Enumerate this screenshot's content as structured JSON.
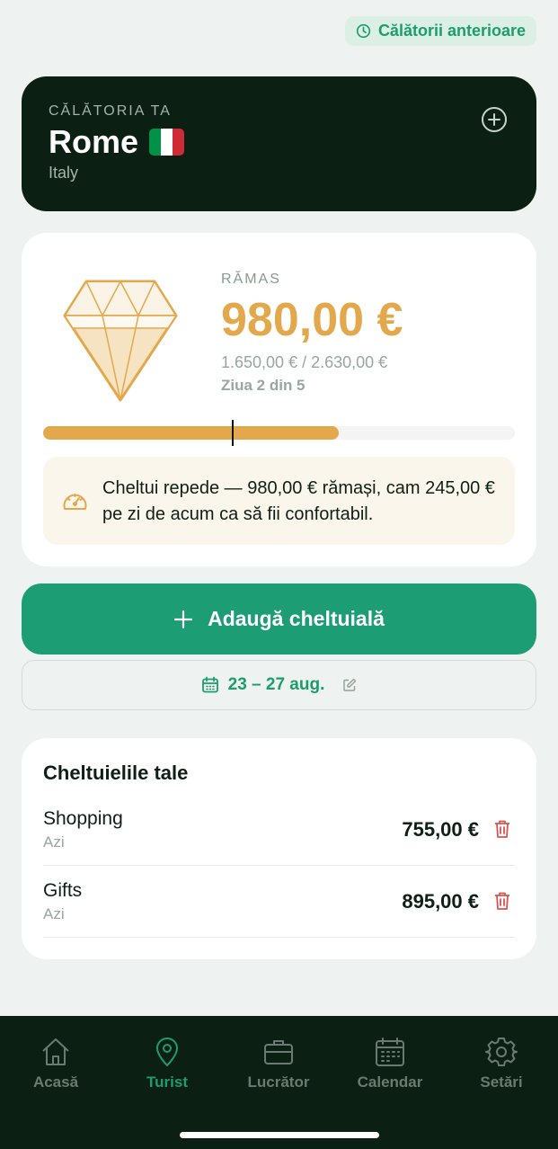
{
  "header": {
    "history_button_label": "Călătorii anterioare"
  },
  "trip": {
    "label": "CĂLĂTORIA TA",
    "city": "Rome",
    "country": "Italy",
    "flag_colors": [
      "#009246",
      "#ffffff",
      "#ce2b37"
    ]
  },
  "budget": {
    "remaining_label": "RĂMAS",
    "remaining_value": "980,00 €",
    "spent_of_total": "1.650,00 € / 2.630,00 €",
    "day_progress": "Ziua 2 din 5",
    "progress_fraction": 0.627,
    "day_marker_fraction": 0.4,
    "tip_text": "Cheltui repede — 980,00 € rămași, cam 245,00 € pe zi de acum ca să fii confortabil."
  },
  "actions": {
    "add_expense_label": "Adaugă cheltuială",
    "date_range_label": "23 – 27 aug."
  },
  "expenses": {
    "title": "Cheltuielile tale",
    "items": [
      {
        "name": "Shopping",
        "date": "Azi",
        "amount": "755,00 €"
      },
      {
        "name": "Gifts",
        "date": "Azi",
        "amount": "895,00 €"
      }
    ]
  },
  "tabbar": {
    "items": [
      {
        "label": "Acasă",
        "icon": "home-icon"
      },
      {
        "label": "Turist",
        "icon": "map-pin-icon",
        "active": true
      },
      {
        "label": "Lucrător",
        "icon": "briefcase-icon"
      },
      {
        "label": "Calendar",
        "icon": "calendar-icon"
      },
      {
        "label": "Setări",
        "icon": "gear-icon"
      }
    ]
  },
  "colors": {
    "accent_green": "#1d9d74",
    "budget_gold": "#e3a84c",
    "dark_bg": "#0b1f13",
    "danger_red": "#d9534f"
  }
}
